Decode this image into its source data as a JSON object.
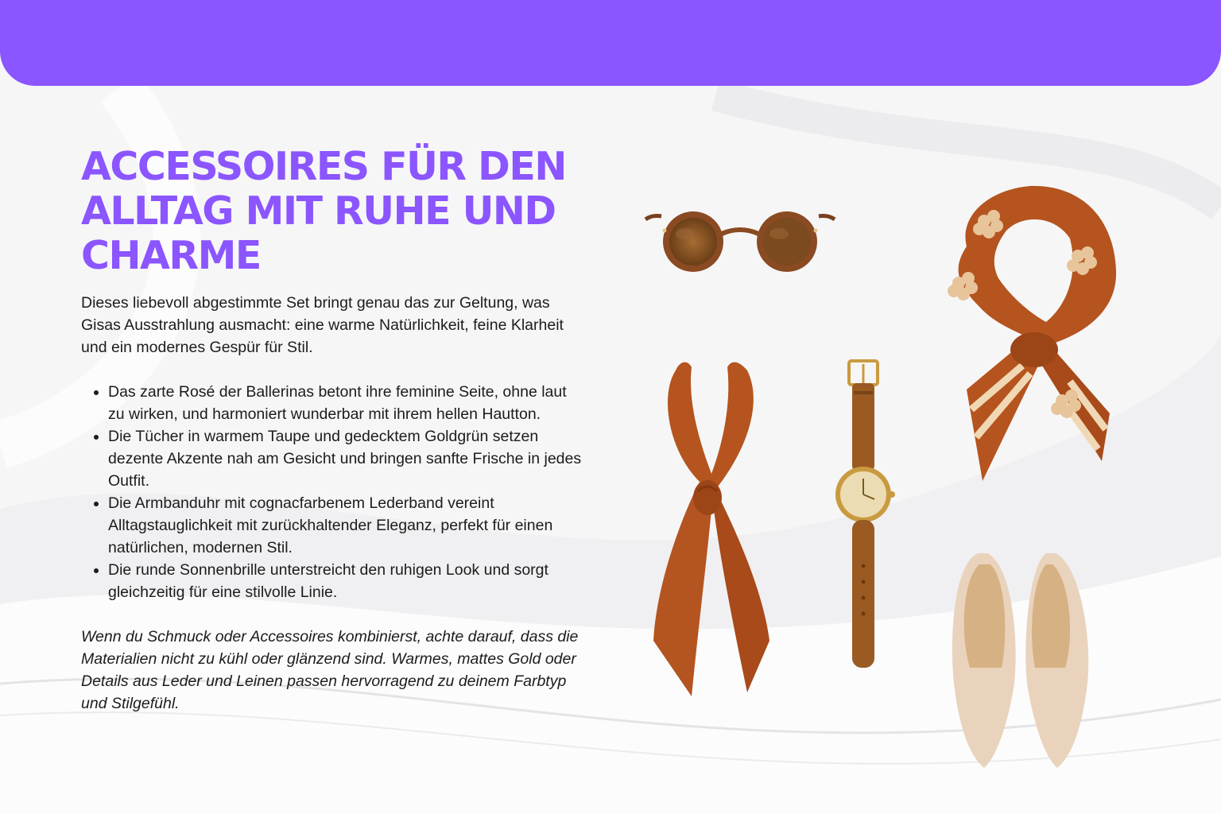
{
  "header": {
    "bar_color": "#8b55ff"
  },
  "title": "ACCESSOIRES FÜR DEN ALLTAG MIT RUHE UND CHARME",
  "intro": "Dieses liebevoll abgestimmte Set bringt genau das zur Geltung, was Gisas Ausstrahlung ausmacht: eine warme Natürlichkeit, feine Klarheit und ein modernes Gespür für Stil.",
  "bullets": [
    "Das zarte Rosé der Ballerinas betont ihre feminine Seite, ohne laut zu wirken, und harmoniert wunderbar mit ihrem hellen Hautton.",
    "Die Tücher in warmem Taupe und gedecktem Goldgrün setzen dezente Akzente nah am Gesicht und bringen sanfte Frische in jedes Outfit.",
    "Die Armbanduhr mit cognacfarbenem Lederband vereint Alltagstauglichkeit mit zurückhaltender Eleganz, perfekt für einen natürlichen, modernen Stil.",
    "Die runde Sonnenbrille unterstreicht den ruhigen Look und sorgt gleichzeitig für eine stilvolle Linie."
  ],
  "tip": "Wenn du Schmuck oder Accessoires kombinierst, achte darauf, dass die Materialien nicht zu kühl oder glänzend sind. Warmes, mattes Gold oder Details aus Leder und Leinen passen hervorragend zu deinem Farbtyp und Stilgefühl.",
  "products": {
    "sunglasses": "round-sunglasses-icon",
    "plain_scarf": "rust-neck-scarf-icon",
    "watch": "leather-watch-icon",
    "floral_scarf": "floral-neck-scarf-icon",
    "ballerinas": "nude-ballerinas-icon"
  },
  "colors": {
    "accent": "#8b55ff",
    "rust": "#b5541e",
    "leather": "#9a5a22",
    "gold": "#c99a3f",
    "nude": "#ead3bc"
  }
}
